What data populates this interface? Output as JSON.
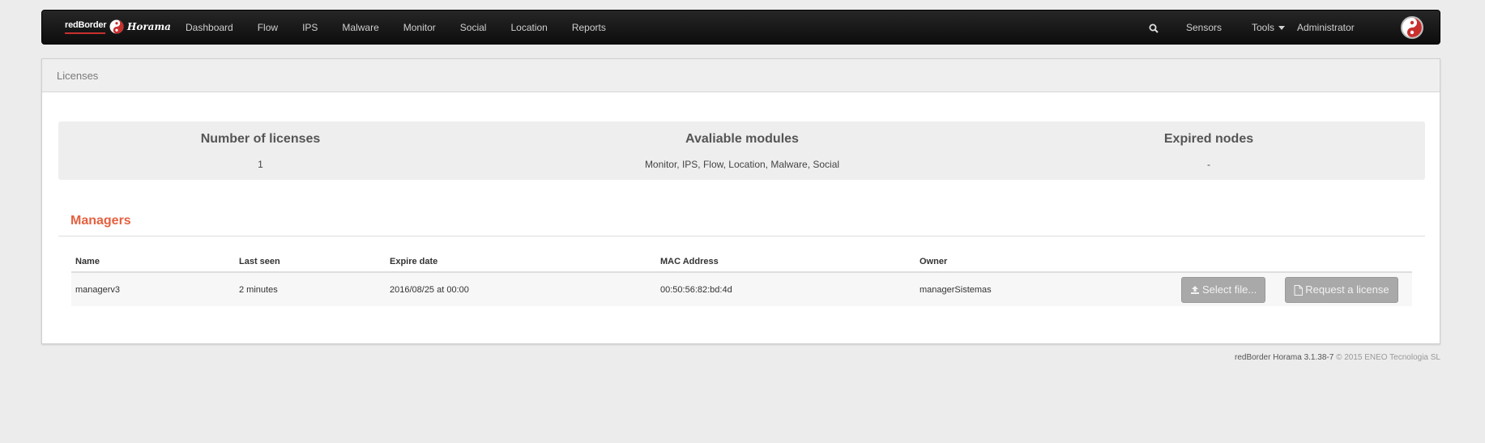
{
  "navbar": {
    "brand_red": "redBorder",
    "brand_name": "Horama",
    "links": [
      "Dashboard",
      "Flow",
      "IPS",
      "Malware",
      "Monitor",
      "Social",
      "Location",
      "Reports"
    ],
    "sensors": "Sensors",
    "tools": "Tools",
    "user": "Administrator"
  },
  "panel": {
    "title": "Licenses"
  },
  "summary": {
    "licenses_label": "Number of licenses",
    "licenses_value": "1",
    "modules_label": "Avaliable modules",
    "modules_value": "Monitor, IPS, Flow, Location, Malware, Social",
    "expired_label": "Expired nodes",
    "expired_value": "-"
  },
  "managers": {
    "title": "Managers",
    "columns": [
      "Name",
      "Last seen",
      "Expire date",
      "MAC Address",
      "Owner"
    ],
    "rows": [
      {
        "name": "managerv3",
        "last_seen": "2 minutes",
        "expire": "2016/08/25 at 00:00",
        "mac": "00:50:56:82:bd:4d",
        "owner": "managerSistemas",
        "select_label": "Select file...",
        "request_label": "Request a license"
      }
    ]
  },
  "footer": {
    "version": "redBorder Horama 3.1.38-7",
    "copyright": "© 2015 ENEO Tecnologia SL"
  },
  "colors": {
    "accent": "#e4603f",
    "navbar": "#111111",
    "button_disabled": "#a9a9a9"
  }
}
